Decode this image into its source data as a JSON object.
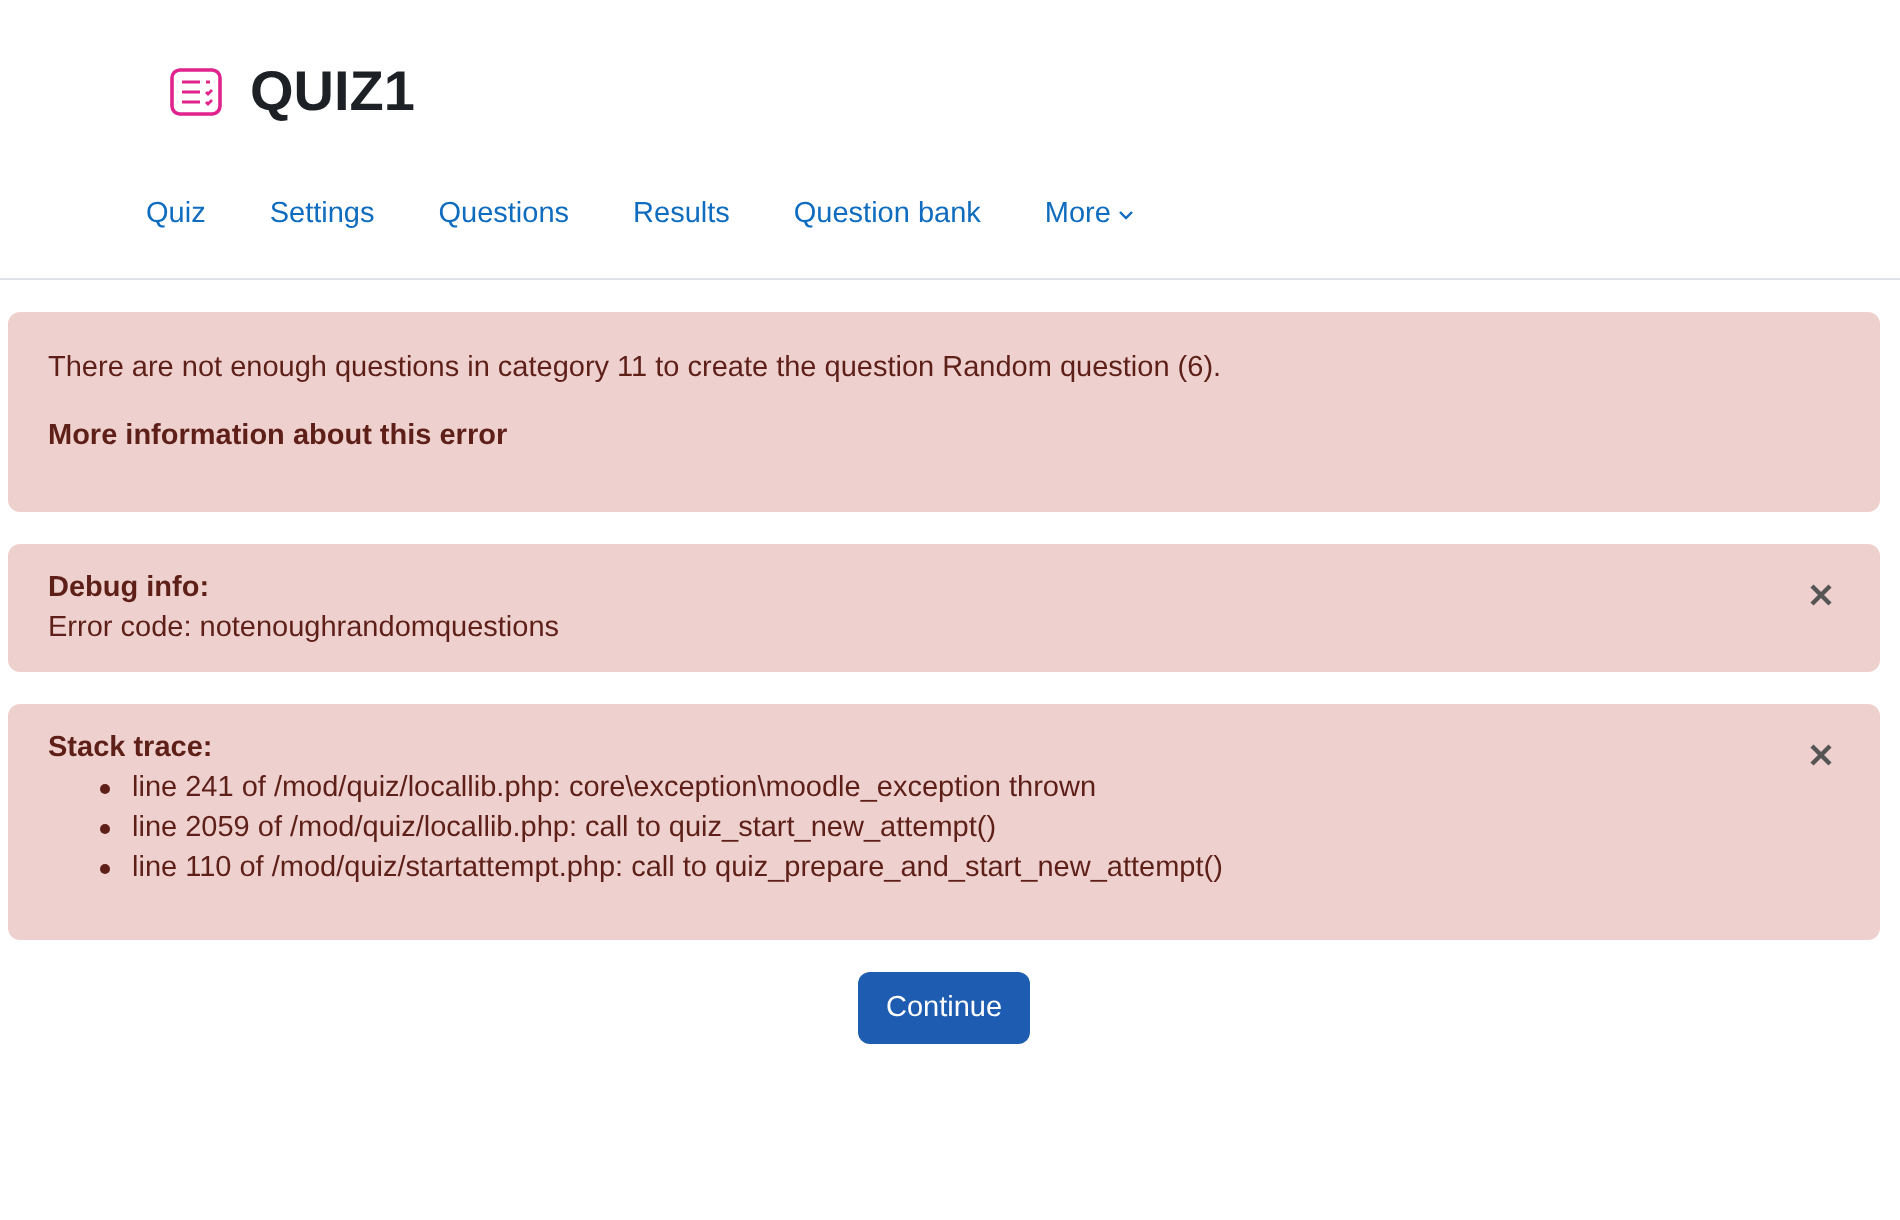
{
  "page": {
    "title": "QUIZ1"
  },
  "nav": [
    {
      "label": "Quiz",
      "kind": "link"
    },
    {
      "label": "Settings",
      "kind": "link"
    },
    {
      "label": "Questions",
      "kind": "link"
    },
    {
      "label": "Results",
      "kind": "link"
    },
    {
      "label": "Question bank",
      "kind": "link"
    },
    {
      "label": "More",
      "kind": "dropdown"
    }
  ],
  "error": {
    "message": "There are not enough questions in category 11 to create the question Random question (6).",
    "more_info": "More information about this error"
  },
  "debug": {
    "heading": "Debug info:",
    "text": "Error code: notenoughrandomquestions"
  },
  "stack": {
    "heading": "Stack trace:",
    "lines": [
      "line 241 of /mod/quiz/locallib.php: core\\exception\\moodle_exception thrown",
      "line 2059 of /mod/quiz/locallib.php: call to quiz_start_new_attempt()",
      "line 110 of /mod/quiz/startattempt.php: call to quiz_prepare_and_start_new_attempt()"
    ]
  },
  "button": "Continue"
}
